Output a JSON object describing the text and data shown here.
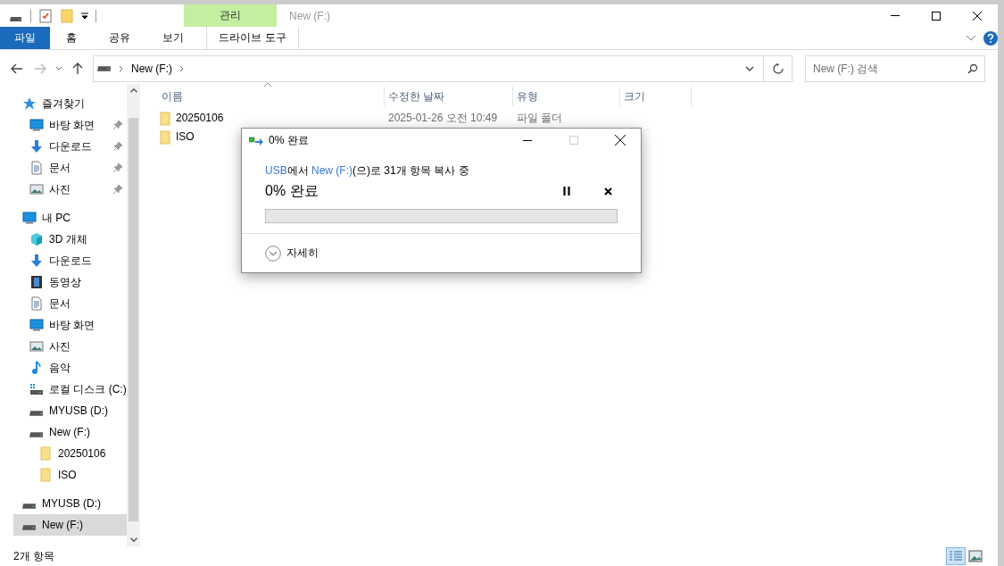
{
  "window": {
    "title": "New (F:)",
    "context_group": "관리"
  },
  "ribbon_tabs": [
    {
      "label": "파일",
      "kind": "file"
    },
    {
      "label": "홈",
      "kind": "normal"
    },
    {
      "label": "공유",
      "kind": "normal"
    },
    {
      "label": "보기",
      "kind": "normal"
    },
    {
      "label": "드라이브 도구",
      "kind": "context"
    }
  ],
  "address": {
    "path": "New (F:)",
    "search_placeholder": "New (F:) 검색"
  },
  "sidebar": [
    {
      "label": "즐겨찾기",
      "kind": "star",
      "selected": false,
      "children": [
        {
          "label": "바탕 화면",
          "kind": "desktop",
          "pinned": true,
          "selected": false
        },
        {
          "label": "다운로드",
          "kind": "download",
          "pinned": true,
          "selected": false
        },
        {
          "label": "문서",
          "kind": "document",
          "pinned": true,
          "selected": false
        },
        {
          "label": "사진",
          "kind": "pictures",
          "pinned": true,
          "selected": false
        }
      ]
    },
    {
      "label": "내 PC",
      "kind": "pc",
      "selected": false,
      "children": [
        {
          "label": "3D 개체",
          "kind": "cube",
          "selected": false
        },
        {
          "label": "다운로드",
          "kind": "download",
          "selected": false
        },
        {
          "label": "동영상",
          "kind": "video",
          "selected": false
        },
        {
          "label": "문서",
          "kind": "document",
          "selected": false
        },
        {
          "label": "바탕 화면",
          "kind": "desktop",
          "selected": false
        },
        {
          "label": "사진",
          "kind": "pictures",
          "selected": false
        },
        {
          "label": "음악",
          "kind": "music",
          "selected": false
        },
        {
          "label": "로컬 디스크 (C:)",
          "kind": "localdisk",
          "selected": false
        },
        {
          "label": "MYUSB (D:)",
          "kind": "drive",
          "selected": false
        },
        {
          "label": "New (F:)",
          "kind": "drive",
          "selected": false,
          "children": [
            {
              "label": "20250106",
              "kind": "folder",
              "selected": false
            },
            {
              "label": "ISO",
              "kind": "folder",
              "selected": false
            }
          ]
        }
      ]
    },
    {
      "label": "MYUSB (D:)",
      "kind": "drive",
      "selected": false
    },
    {
      "label": "New (F:)",
      "kind": "drive",
      "selected": true
    }
  ],
  "table": {
    "columns": [
      "이름",
      "수정한 날짜",
      "유형",
      "크기"
    ],
    "rows": [
      {
        "name": "20250106",
        "modified": "2025-01-26 오전 10:49",
        "type": "파일 폴더"
      },
      {
        "name": "ISO"
      }
    ]
  },
  "dialog": {
    "title": "0% 완료",
    "message": [
      {
        "text": "USB",
        "link": true
      },
      {
        "text": "에서 ",
        "link": false
      },
      {
        "text": "New (F:)",
        "link": true
      },
      {
        "text": "(으)로 31개 항목 복사 중",
        "link": false
      }
    ],
    "heading": "0% 완료",
    "progress": {
      "level": 0
    },
    "details": "자세히"
  },
  "status_bar": {
    "count": "2개 항목",
    "views": [
      {
        "kind": "details",
        "selected": true
      },
      {
        "kind": "large",
        "selected": false
      }
    ]
  }
}
